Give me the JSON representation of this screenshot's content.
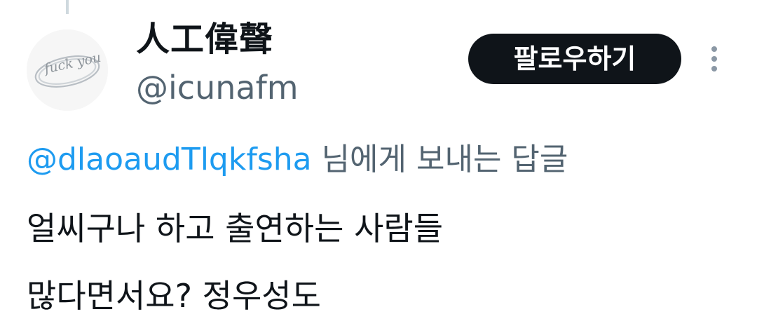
{
  "user": {
    "display_name": "人工偉聲",
    "handle": "@icunafm",
    "avatar_text": "fuck you"
  },
  "actions": {
    "follow_label": "팔로우하기",
    "more_icon": "more-vertical-icon"
  },
  "reply": {
    "mention": "@dlaoaudTlqkfsha",
    "suffix": " 님에게 보내는 답글"
  },
  "tweet": {
    "lines": [
      "얼씨구나 하고 출연하는 사람들",
      "많다면서요? 정우성도"
    ]
  },
  "colors": {
    "link": "#1d9bf0",
    "secondary": "#536471",
    "text": "#0f1419",
    "button_bg": "#0f1419",
    "thread_line": "#cfd9de"
  }
}
